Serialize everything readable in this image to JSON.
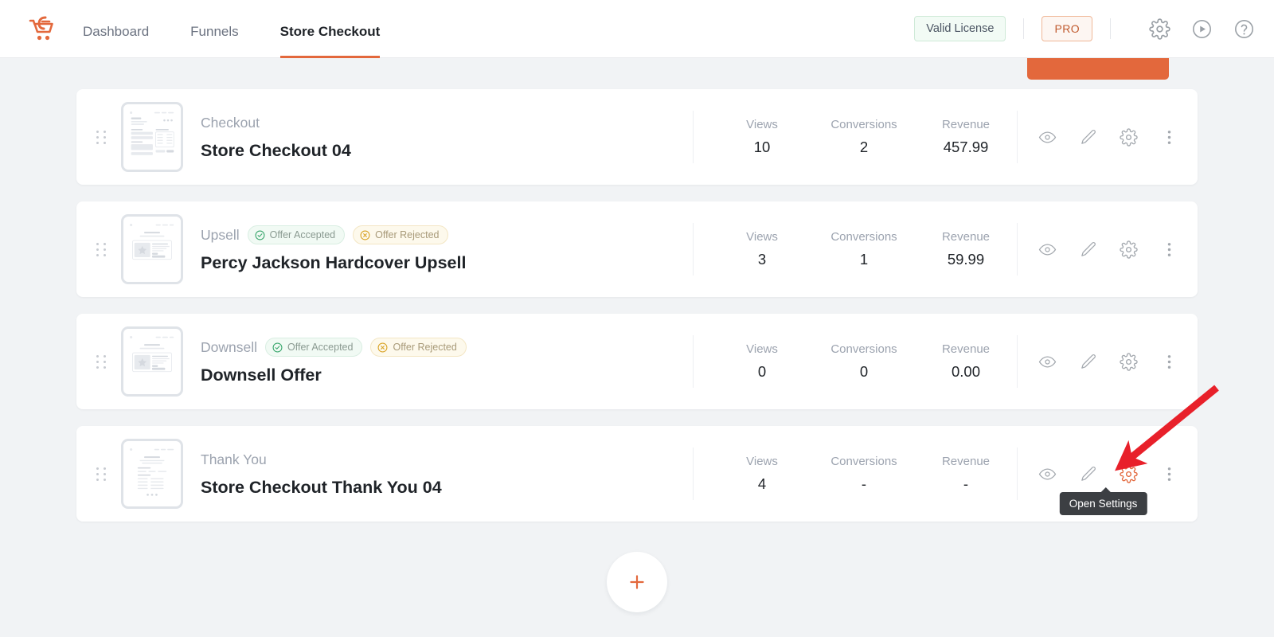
{
  "header": {
    "logo_icon": "cartflows-cart-logo",
    "nav": [
      {
        "label": "Dashboard",
        "active": false
      },
      {
        "label": "Funnels",
        "active": false
      },
      {
        "label": "Store Checkout",
        "active": true
      }
    ],
    "license_badge": "Valid License",
    "pro_badge": "PRO",
    "icons": [
      {
        "name": "gear-icon"
      },
      {
        "name": "play-circle-icon"
      },
      {
        "name": "help-circle-icon"
      }
    ]
  },
  "stat_headers": {
    "views": "Views",
    "conversions": "Conversions",
    "revenue": "Revenue"
  },
  "pills": {
    "accepted": "Offer Accepted",
    "rejected": "Offer Rejected"
  },
  "rows": [
    {
      "type": "Checkout",
      "title": "Store Checkout 04",
      "thumb": "checkout",
      "pills": [],
      "views": "10",
      "conversions": "2",
      "revenue": "457.99",
      "tooltip": null,
      "highlight_gear": false
    },
    {
      "type": "Upsell",
      "title": "Percy Jackson Hardcover Upsell",
      "thumb": "offer",
      "pills": [
        "accepted",
        "rejected"
      ],
      "views": "3",
      "conversions": "1",
      "revenue": "59.99",
      "tooltip": null,
      "highlight_gear": false
    },
    {
      "type": "Downsell",
      "title": "Downsell Offer",
      "thumb": "offer",
      "pills": [
        "accepted",
        "rejected"
      ],
      "views": "0",
      "conversions": "0",
      "revenue": "0.00",
      "tooltip": null,
      "highlight_gear": false
    },
    {
      "type": "Thank You",
      "title": "Store Checkout Thank You 04",
      "thumb": "thankyou",
      "pills": [],
      "views": "4",
      "conversions": "-",
      "revenue": "-",
      "tooltip": "Open Settings",
      "highlight_gear": true
    }
  ],
  "row_actions": [
    {
      "name": "preview-icon"
    },
    {
      "name": "edit-icon"
    },
    {
      "name": "settings-gear-icon"
    },
    {
      "name": "more-options-icon"
    }
  ],
  "add_step_button": {
    "icon": "plus-icon"
  },
  "annotation": {
    "arrow_color": "#e8202a"
  },
  "colors": {
    "accent": "#e3683c",
    "page_bg": "#f1f3f5",
    "card_bg": "#ffffff",
    "accepted_green": "#3aa76d",
    "rejected_amber": "#d9a326",
    "tooltip_bg": "#3c3f43"
  }
}
